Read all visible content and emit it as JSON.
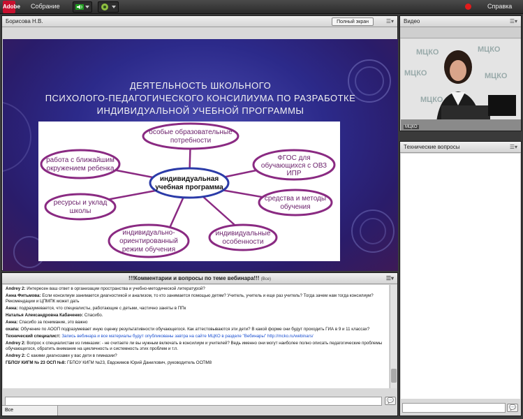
{
  "app": {
    "logo_text": "Adobe",
    "meeting_menu": "Собрание",
    "help": "Справка"
  },
  "share_pod": {
    "presenter": "Борисова Н.В.",
    "fullscreen_label": "Полный экран"
  },
  "slide": {
    "title_lines": [
      "ДЕЯТЕЛЬНОСТЬ ШКОЛЬНОГО",
      "ПСИХОЛОГО-ПЕДАГОГИЧЕСКОГО КОНСИЛИУМА ПО РАЗРАБОТКЕ",
      "ИНДИВИДУАЛЬНОЙ УЧЕБНОЙ ПРОГРАММЫ"
    ],
    "center": [
      "индивидуальная",
      "учебная программа"
    ],
    "nodes": [
      [
        "особые образовательные",
        "потребности"
      ],
      [
        "ФГОС для",
        "обучающихся с ОВЗ",
        "ИПР"
      ],
      [
        "средства и методы",
        "обучения"
      ],
      [
        "индивидуальные",
        "особенности"
      ],
      [
        "индивидуально-",
        "ориентированный",
        "режим обучения"
      ],
      [
        "ресурсы и уклад",
        "школы"
      ],
      [
        "работа с ближайшим",
        "окружением ребенка"
      ]
    ]
  },
  "video_pod": {
    "title": "Видео",
    "cam_label": "МЦКО",
    "wall_text": "МЦКО"
  },
  "tech_pod": {
    "title": "Технические вопросы"
  },
  "chat_pod": {
    "title": "!!!Комментарии и вопросы по теме вебинара!!!",
    "scope": "(Все)",
    "target": "Все",
    "messages": [
      {
        "author": "Andrey 2:",
        "text": "Интересен ваш ответ в организации пространства и учебно-методической литературой?"
      },
      {
        "author": "Анна Фитьмова:",
        "text": "Если консилиум занимается диагностикой и анализом, то кто занимается помощью детям? Учитель, учитель и еще раз учитель? Тогда зачем нам тогда консилиум? Рекомендации и ЦПМПК может дать"
      },
      {
        "author": "Анна:",
        "text": "подразумевается, что специалисты, работающие с детьми,  частично заняты в ППк"
      },
      {
        "author": "Наталья  Александровна Кабаченко:",
        "text": "Спасибо."
      },
      {
        "author": "Анна:",
        "text": "Спасибо за понимание, это важно"
      },
      {
        "author": "охапа:",
        "text": "Обучение по АООП подразумевает иную оценку результативности обучающегося. Как аттестовываются эти дети? В какой форме они будут проходить ГИА в 9 и 11 классах?"
      },
      {
        "author": "Технический специалист:",
        "text": "Запись вебинара и все материалы будут опубликованы завтра на сайте МЦКО в разделе \"Вебинары\"",
        "link": "http://mcko.ru/webinars/"
      },
      {
        "author": "Andrey 2:",
        "text": "Вопрос к специалистам из гимназии: - не считаете ли вы нужным включать в консилиум и учителей? Ведь именно они могут наиболее полно описать педагогические проблемы обучающегося, обратить внимание на цикличность и системность этих проблем и т.п."
      },
      {
        "author": "Andrey 2:",
        "text": "С какими диагнозами у вас дети в гимназии?"
      },
      {
        "author": "ГБПОУ КИГМ № 23 ОСП №8:",
        "text": "ГБПОУ КИГМ №23, Евдокимов Юрий Данилович, руководитель ОСПМ8"
      }
    ]
  }
}
